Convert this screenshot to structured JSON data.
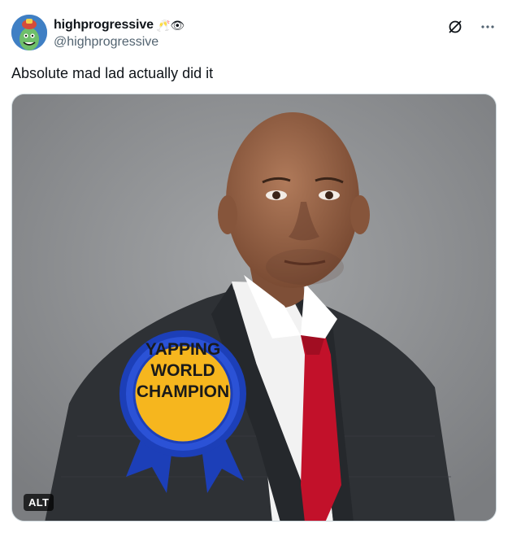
{
  "author": {
    "display_name": "highprogressive",
    "emojis": "🥂👁",
    "handle": "@highprogressive"
  },
  "actions": {
    "grok_icon": "grok-icon",
    "more_icon": "more-icon",
    "more_label": "···"
  },
  "tweet": {
    "text": "Absolute mad lad actually did it"
  },
  "media": {
    "badge": {
      "line1": "YAPPING",
      "line2": "WORLD",
      "line3": "CHAMPION"
    },
    "alt_label": "ALT"
  },
  "colors": {
    "background_gray": "#8e9092",
    "badge_gold": "#f6b61e",
    "badge_blue": "#1c3fb8",
    "tie_red": "#c2112a",
    "suit_dark": "#2e3135"
  }
}
